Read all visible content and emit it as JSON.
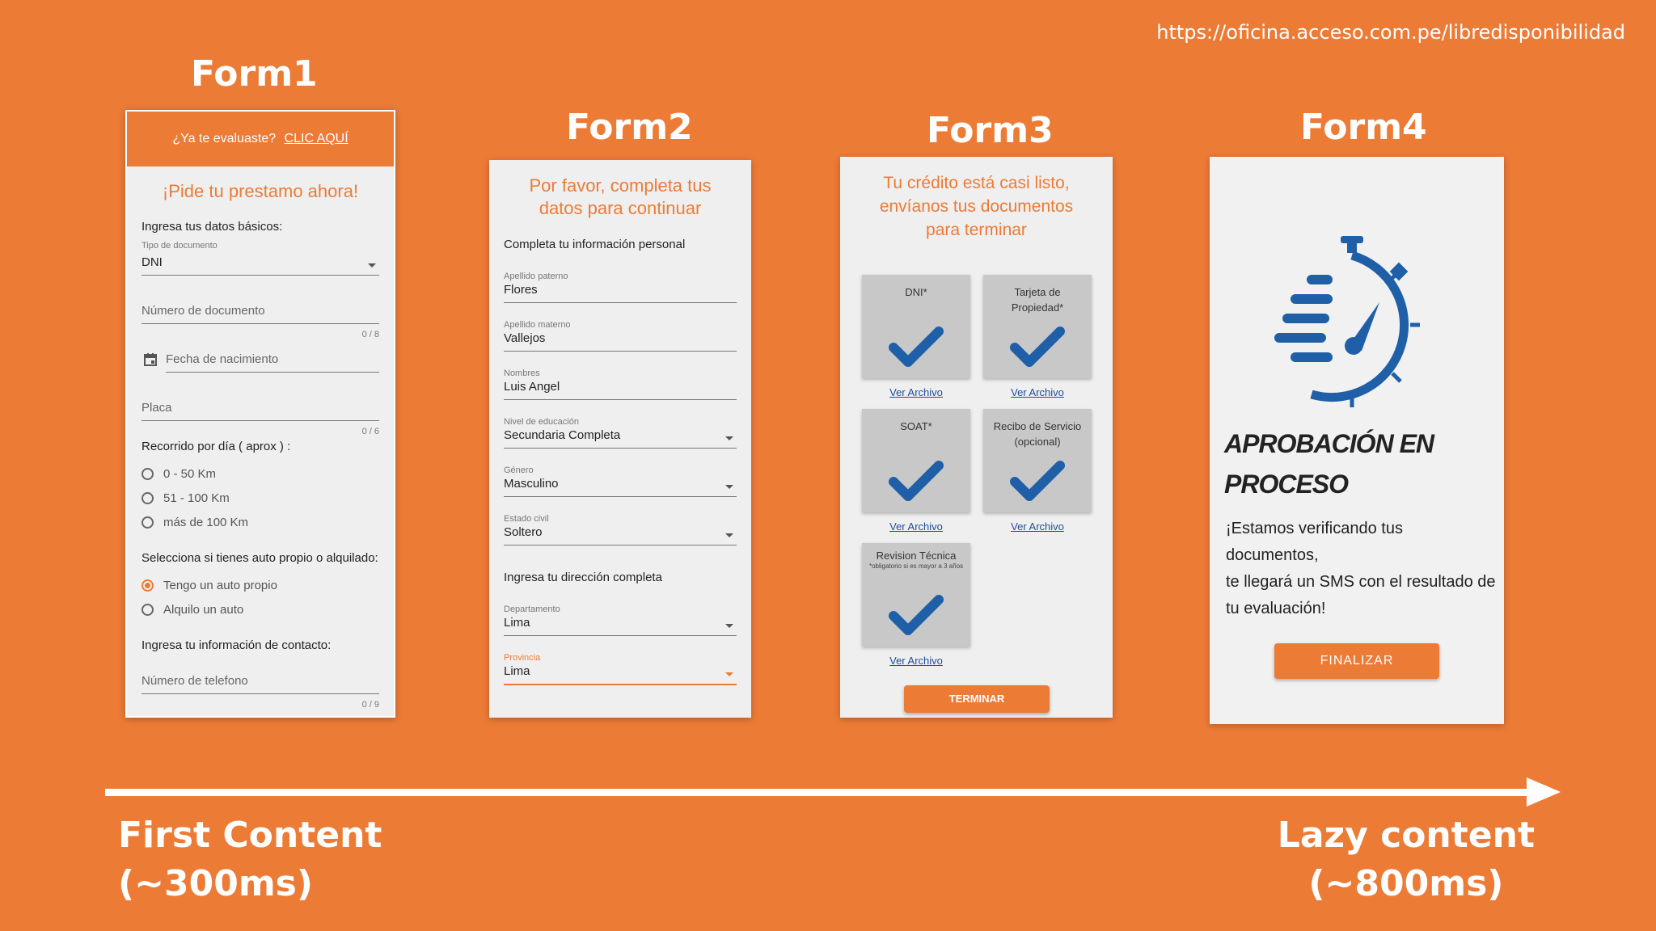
{
  "url": "https://oficina.acceso.com.pe/libredisponibilidad",
  "titles": {
    "form1": "Form1",
    "form2": "Form2",
    "form3": "Form3",
    "form4": "Form4"
  },
  "form1": {
    "header_question": "¿Ya te evaluaste?",
    "header_link": "CLIC AQUÍ",
    "heading": "¡Pide tu prestamo ahora!",
    "basic_label": "Ingresa tus datos básicos:",
    "doc_type_label": "Tipo de documento",
    "doc_type_value": "DNI",
    "doc_number_ph": "Número de documento",
    "doc_number_counter": "0 / 8",
    "birth_ph": "Fecha de nacimiento",
    "placa_ph": "Placa",
    "placa_counter": "0 / 6",
    "recorrido_label": "Recorrido por día ( aprox ) :",
    "recorrido_options": [
      "0 - 50 Km",
      "51 - 100 Km",
      "más de 100 Km"
    ],
    "auto_label": "Selecciona si tienes auto propio o alquilado:",
    "auto_options": [
      "Tengo un auto propio",
      "Alquilo un auto"
    ],
    "contact_label": "Ingresa tu información de contacto:",
    "phone_ph": "Número de telefono",
    "phone_counter": "0 / 9"
  },
  "form2": {
    "heading_line1": "Por favor, completa tus",
    "heading_line2": "datos para continuar",
    "personal_label": "Completa tu información personal",
    "fields": [
      {
        "label": "Apellido paterno",
        "value": "Flores"
      },
      {
        "label": "Apellido materno",
        "value": "Vallejos"
      },
      {
        "label": "Nombres",
        "value": "Luis Angel"
      },
      {
        "label": "Nivel de educación",
        "value": "Secundaria Completa"
      },
      {
        "label": "Género",
        "value": "Masculino"
      },
      {
        "label": "Estado civil",
        "value": "Soltero"
      }
    ],
    "address_label": "Ingresa tu dirección completa",
    "departamento_label": "Departamento",
    "departamento_value": "Lima",
    "provincia_label": "Provincia",
    "provincia_value": "Lima"
  },
  "form3": {
    "heading_line1": "Tu crédito está casi listo,",
    "heading_line2": "envíanos tus documentos",
    "heading_line3": "para terminar",
    "docs": {
      "dni": "DNI*",
      "tarjeta_line1": "Tarjeta de",
      "tarjeta_line2": "Propiedad*",
      "soat": "SOAT*",
      "recibo_line1": "Recibo de Servicio",
      "recibo_line2": "(opcional)",
      "revision": "Revision Técnica",
      "revision_note": "*obligatorio si es mayor a 3 años"
    },
    "ver_archivo": "Ver Archivo",
    "button": "TERMINAR",
    "check_color": "#1F5FA8"
  },
  "form4": {
    "heading_line1": "APROBACIÓN EN",
    "heading_line2": "PROCESO",
    "message_line1": "¡Estamos verificando tus",
    "message_line2": "documentos,",
    "message_line3": "te llegará un SMS con el resultado de",
    "message_line4": "tu evaluación!",
    "button": "FINALIZAR",
    "icon_color": "#1F5FA8"
  },
  "bottom": {
    "left_line1": "First Content",
    "left_line2": "(~300ms)",
    "right_line1": "Lazy content",
    "right_line2": "(~800ms)"
  },
  "colors": {
    "background": "#EC7B36",
    "accent": "#EC7B36",
    "link": "#1F4E9C"
  }
}
